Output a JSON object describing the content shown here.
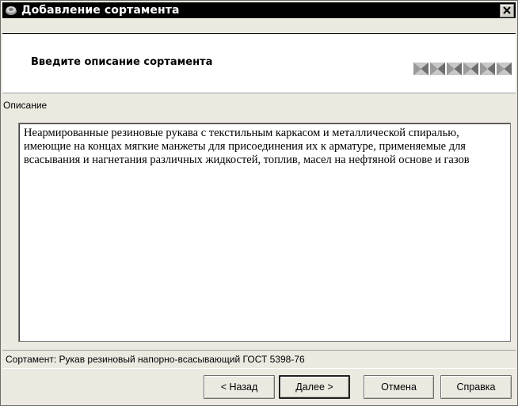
{
  "window": {
    "title": "Добавление сортамента",
    "close_glyph": "✕"
  },
  "header": {
    "title": "Введите описание сортамента",
    "steps_total": 6
  },
  "description": {
    "label": "Описание",
    "text": "Неармированные резиновые рукава с текстильным каркасом и металлической спиралью, имеющие на концах мягкие манжеты для присоединения их к арматуре, применяемые для всасывания и нагнетания различных жидкостей, топлив, масел на нефтяной основе и газов"
  },
  "status": {
    "text": "Сортамент: Рукав резиновый напорно-всасывающий ГОСТ 5398-76"
  },
  "buttons": {
    "back": "< Назад",
    "next": "Далее >",
    "cancel": "Отмена",
    "help": "Справка"
  },
  "colors": {
    "titlebar": "#000000",
    "dialog_bg": "#ece9e1",
    "panel_bg": "#ffffff",
    "step_light": "#b8b8b8",
    "step_dark": "#6e6e6e"
  },
  "icons": {
    "app": "assortment-icon",
    "close": "close-icon",
    "step": "step-indicator-icon"
  }
}
